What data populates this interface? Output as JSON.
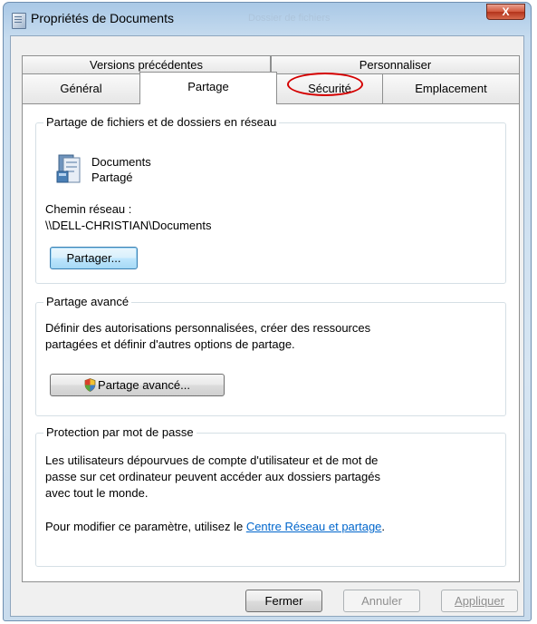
{
  "window": {
    "title": "Propriétés de Documents",
    "ghost_title": "Dossier de fichiers",
    "close_label": "X"
  },
  "tabs": {
    "row1": [
      {
        "label": "Versions précédentes"
      },
      {
        "label": "Personnaliser"
      }
    ],
    "row2": [
      {
        "label": "Général"
      },
      {
        "label": "Partage",
        "active": true
      },
      {
        "label": "Sécurité",
        "highlighted": true
      },
      {
        "label": "Emplacement"
      }
    ]
  },
  "network_sharing": {
    "group_label": "Partage de fichiers et de dossiers en réseau",
    "folder_name": "Documents",
    "folder_status": "Partagé",
    "path_label": "Chemin réseau :",
    "path_value": "\\\\DELL-CHRISTIAN\\Documents",
    "share_button": "Partager..."
  },
  "advanced_sharing": {
    "group_label": "Partage avancé",
    "description_line1": "Définir des autorisations personnalisées, créer des ressources",
    "description_line2": "partagées et définir d'autres options de partage.",
    "button_label": "Partage avancé..."
  },
  "password_protection": {
    "group_label": "Protection par mot de passe",
    "line1": "Les utilisateurs dépourvues de compte d'utilisateur et de mot de",
    "line2": "passe sur cet ordinateur peuvent accéder aux dossiers partagés",
    "line3": "avec tout le monde.",
    "modify_prefix": "Pour modifier ce paramètre, utilisez le ",
    "modify_link": "Centre Réseau et partage",
    "modify_suffix": "."
  },
  "footer": {
    "close": "Fermer",
    "cancel": "Annuler",
    "apply": "Appliquer"
  },
  "colors": {
    "highlight_circle": "#d40000",
    "link": "#0066cc"
  },
  "icons": [
    "folder-icon",
    "shield-icon",
    "window-icon",
    "close-icon"
  ]
}
